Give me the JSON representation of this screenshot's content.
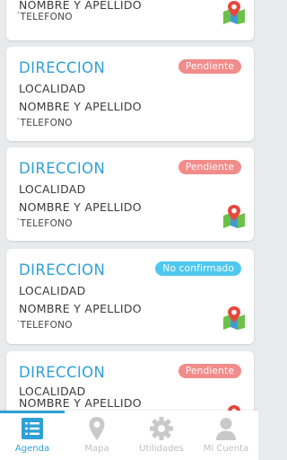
{
  "cards": [
    {
      "name": "NOMBRE Y APELLIDO",
      "telefono": "TELEFONO",
      "has_map": true
    },
    {
      "direccion": "DIRECCION",
      "localidad": "LOCALIDAD",
      "name": "NOMBRE Y APELLIDO",
      "telefono": "TELEFONO",
      "status": "Pendiente",
      "has_map": false
    },
    {
      "direccion": "DIRECCION",
      "localidad": "LOCALIDAD",
      "name": "NOMBRE Y APELLIDO",
      "telefono": "TELEFONO",
      "status": "Pendiente",
      "has_map": true
    },
    {
      "direccion": "DIRECCION",
      "localidad": "LOCALIDAD",
      "name": "NOMBRE Y APELLIDO",
      "telefono": "TELEFONO",
      "status": "No confirmado",
      "has_map": true
    },
    {
      "direccion": "DIRECCION",
      "localidad": "LOCALIDAD",
      "name": "NOMBRE Y APELLIDO",
      "status": "Pendiente",
      "has_map": true
    }
  ],
  "nav": {
    "items": [
      {
        "label": "Agenda",
        "icon": "list-icon",
        "active": true
      },
      {
        "label": "Mapa",
        "icon": "map-pin-icon",
        "active": false
      },
      {
        "label": "Utilidades",
        "icon": "gear-icon",
        "active": false
      },
      {
        "label": "Mi Cuenta",
        "icon": "user-icon",
        "active": false
      }
    ]
  },
  "colors": {
    "accent": "#2ea0d6",
    "pendiente": "#f28c8a",
    "no_confirmado": "#4fc8ef",
    "nav_inactive": "#bfbfbf",
    "background": "#e9eaec"
  }
}
